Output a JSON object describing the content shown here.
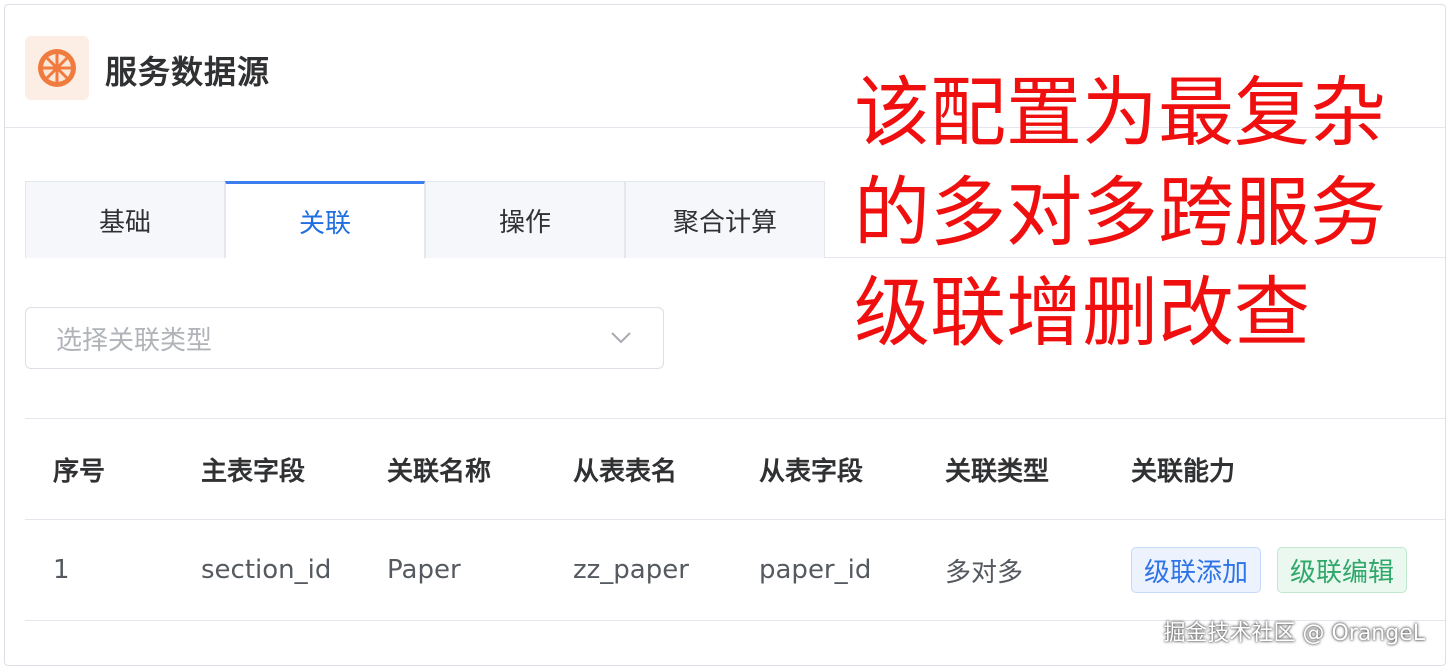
{
  "header": {
    "logo_icon": "orange-slice-icon",
    "title": "服务数据源"
  },
  "annotation": {
    "lines": [
      "该配置为最复杂",
      "的多对多跨服务",
      "级联增删改查"
    ],
    "color": "#f00f0f"
  },
  "tabs": [
    {
      "label": "基础",
      "active": false
    },
    {
      "label": "关联",
      "active": true
    },
    {
      "label": "操作",
      "active": false
    },
    {
      "label": "聚合计算",
      "active": false
    }
  ],
  "relation_select": {
    "placeholder": "选择关联类型",
    "icon": "chevron-down-icon"
  },
  "table": {
    "columns": [
      "序号",
      "主表字段",
      "关联名称",
      "从表表名",
      "从表字段",
      "关联类型",
      "关联能力"
    ],
    "rows": [
      {
        "index": "1",
        "main_field": "section_id",
        "relation_name": "Paper",
        "sub_table": "zz_paper",
        "sub_field": "paper_id",
        "relation_type": "多对多",
        "abilities": [
          "级联添加",
          "级联编辑"
        ]
      }
    ]
  },
  "watermark": "掘金技术社区 @ OrangeL",
  "colors": {
    "accent": "#3c7ef0",
    "tag_blue": "#2f74e6",
    "tag_green": "#2fa86a",
    "logo_orange": "#f07b3f"
  }
}
